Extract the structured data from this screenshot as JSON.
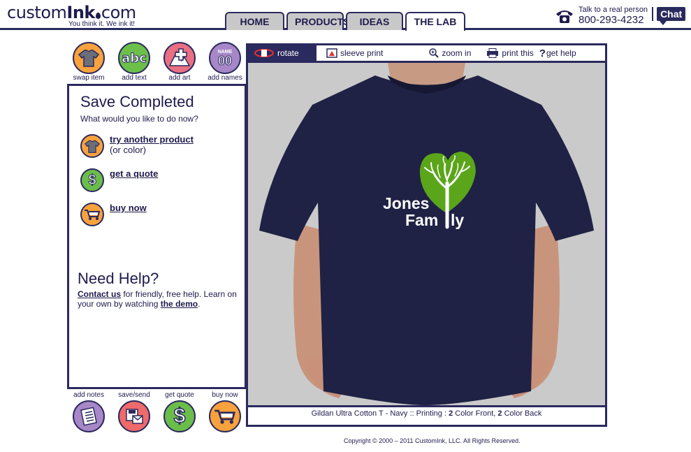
{
  "logo": {
    "custom": "custom",
    "ink": "Ink",
    "com": "com",
    "tagline": "You think it. We ink it!"
  },
  "nav": {
    "tabs": [
      "HOME",
      "PRODUCTS",
      "IDEAS",
      "THE LAB"
    ],
    "active": "THE LAB"
  },
  "contact": {
    "label": "Talk to a real person",
    "phone": "800-293-4232",
    "chat": "Chat"
  },
  "tools_top": [
    {
      "label": "swap item",
      "icon": "shirt-icon"
    },
    {
      "label": "add text",
      "icon": "abc-icon",
      "glyph": "abc"
    },
    {
      "label": "add art",
      "icon": "add-art-icon"
    },
    {
      "label": "add names",
      "icon": "names-icon",
      "glyph_top": "NAME",
      "glyph_num": "00"
    }
  ],
  "tools_bottom": [
    {
      "label": "add notes",
      "icon": "notes-icon"
    },
    {
      "label": "save/send",
      "icon": "save-send-icon"
    },
    {
      "label": "get quote",
      "icon": "dollar-icon"
    },
    {
      "label": "buy now",
      "icon": "cart-icon"
    }
  ],
  "panel": {
    "title": "Save Completed",
    "subtitle": "What would you like to do now?",
    "actions": [
      {
        "link": "try another product",
        "sub": "(or color)"
      },
      {
        "link": "get a quote",
        "sub": ""
      },
      {
        "link": "buy now",
        "sub": ""
      }
    ],
    "help_title": "Need Help?",
    "help_link1": "Contact us",
    "help_text1": " for friendly, free help. Learn on your own by watching ",
    "help_link2": "the demo",
    "help_text2": "."
  },
  "toolbar": {
    "rotate": "rotate",
    "sleeve": "sleeve print",
    "zoom": "zoom in",
    "print": "print this",
    "help": "get help"
  },
  "design": {
    "line1": "Jones",
    "line2a": "Fam",
    "line2b": "ly"
  },
  "caption": {
    "product": "Gildan Ultra Cotton T - Navy :: Printing : ",
    "front_count": "2",
    "front_label": " Color Front, ",
    "back_count": "2",
    "back_label": " Color Back"
  },
  "copyright": "Copyright © 2000 – 2011 CustomInk, LLC. All Rights Reserved.",
  "colors": {
    "navy": "#2b2a5e",
    "shirt": "#1f2244",
    "heart": "#5aa51a"
  }
}
